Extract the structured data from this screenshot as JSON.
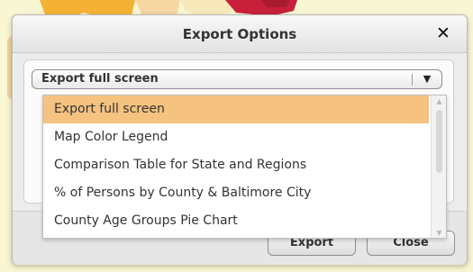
{
  "dialog": {
    "title": "Export Options",
    "close_icon": "close-icon"
  },
  "select": {
    "value": "Export full screen",
    "arrow_icon": "chevron-down-icon"
  },
  "dropdown": {
    "options": [
      "Export full screen",
      "Map Color Legend",
      "Comparison Table for State and Regions",
      "% of Persons by County & Baltimore City",
      "County Age Groups Pie Chart"
    ],
    "selected_index": 0,
    "selected_color": "#f5c27f"
  },
  "footer": {
    "export_label": "Export",
    "close_label": "Close"
  },
  "colors": {
    "page_background": "#f9f6d3",
    "map_orange": "#f4b235",
    "map_red": "#c8203a"
  }
}
